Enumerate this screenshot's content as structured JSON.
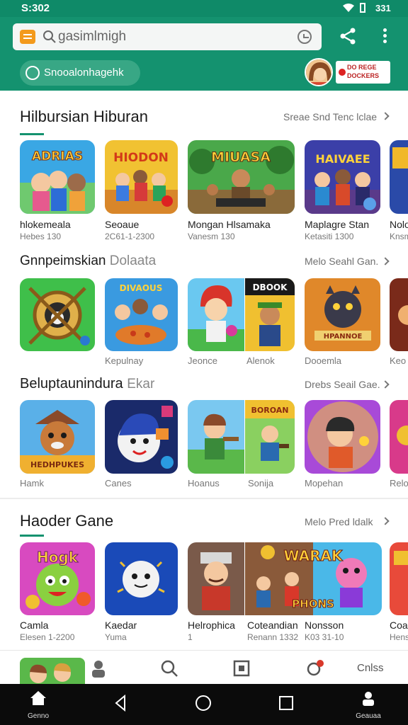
{
  "status": {
    "time": "S:302",
    "battery": "331"
  },
  "header": {
    "search_placeholder": "gasimlmigh",
    "chip_label": "Snooalonhagehk",
    "promo_line1": "DO REGE",
    "promo_line2": "DOCKERS"
  },
  "sections": [
    {
      "title": "Hilbursian Hiburan",
      "more": "Sreae Snd Tenc lclae",
      "games": [
        {
          "name": "hlokemeala",
          "sub": "Hebes 130",
          "art_text": "ADRIAS"
        },
        {
          "name": "Seoaue",
          "sub": "2C61-1-2300",
          "art_text": "HIODON"
        },
        {
          "name": "Mongan Hlsamaka",
          "sub": "Vanesm 130",
          "art_text": "MIUASA"
        },
        {
          "name": "Maplagre Stan",
          "sub": "Ketasiti 1300",
          "art_text": "HAIVAEE"
        },
        {
          "name": "Nolo",
          "sub": "Knsm"
        }
      ]
    },
    {
      "title": "Gnnpeimskian",
      "title_light": "Dolaata",
      "more": "Melo Seahl Gan.",
      "games": [
        {
          "name": "",
          "sub": ""
        },
        {
          "name": "Kepulnay",
          "sub": "",
          "art_text": "DIVAOUS"
        },
        {
          "name": "Jeonce",
          "sub": ""
        },
        {
          "name": "Alenok",
          "sub": "",
          "art_text": "DBOOK"
        },
        {
          "name": "Dooemla",
          "sub": "",
          "art_text": "HPANNOE"
        },
        {
          "name": "Keo",
          "sub": ""
        }
      ]
    },
    {
      "title": "Beluptaunindura",
      "title_light": "Ekar",
      "more": "Drebs Seail Gae.",
      "games": [
        {
          "name": "Hamk",
          "sub": "",
          "art_text": "HEDHPUKES"
        },
        {
          "name": "Canes",
          "sub": ""
        },
        {
          "name": "Hoanus",
          "sub": ""
        },
        {
          "name": "Sonija",
          "sub": "",
          "art_text": "BOROAN"
        },
        {
          "name": "Mopehan",
          "sub": ""
        },
        {
          "name": "Relo",
          "sub": ""
        }
      ]
    },
    {
      "title": "Haoder Gane",
      "more": "Melo Pred ldalk",
      "games": [
        {
          "name": "Camla",
          "sub": "Elesen 1-2200",
          "art_text": "Hogk"
        },
        {
          "name": "Kaedar",
          "sub": "Yuma"
        },
        {
          "name": "Helrophica",
          "sub": "1"
        },
        {
          "name": "Coteandian",
          "sub": "Renann 1332",
          "art_text": "WARAK"
        },
        {
          "name": "Nonsson",
          "sub": "K03 31-10",
          "art_text": "PHONS"
        },
        {
          "name": "Coa",
          "sub": "Hens"
        }
      ]
    }
  ],
  "bottom_tabs": {
    "extra_label": "Cnlss"
  },
  "nav": {
    "home_label": "Genno",
    "profile_label": "Geauaa"
  },
  "colors": {
    "brand_green": "#14926f",
    "status_green": "#0f8a68"
  }
}
